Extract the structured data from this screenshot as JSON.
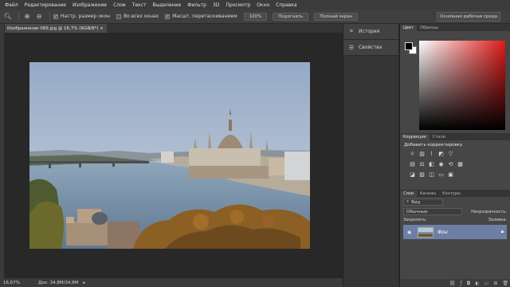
{
  "menu": [
    "Файл",
    "Редактирование",
    "Изображение",
    "Слои",
    "Текст",
    "Выделение",
    "Фильтр",
    "3D",
    "Просмотр",
    "Окно",
    "Справка"
  ],
  "options": {
    "checkbox_resize": "Настр. размер окон",
    "checkbox_all_windows": "Во всех окнах",
    "checkbox_scrubby": "Масшт. перетаскиванием",
    "btn_100": "100%",
    "btn_fit": "Подогнать",
    "btn_fullscreen": "Полный экран",
    "workspace": "Основная рабочая среда"
  },
  "document": {
    "tab_title": "Изображение 089.jpg @ 16,7% (RGB/8*)",
    "zoom": "16,67%",
    "doc_size": "Док: 34,8M/34,8M"
  },
  "dock": {
    "history": "История",
    "properties": "Свойства"
  },
  "panels": {
    "color_tabs": [
      "Цвет",
      "Образцы"
    ],
    "adj_tabs": [
      "Коррекция",
      "Стили"
    ],
    "adj_title": "Добавить корректировку",
    "layer_tabs": [
      "Слои",
      "Каналы",
      "Контуры"
    ],
    "layer_kind": "Вид",
    "blend_mode": "Обычные",
    "opacity_label": "Непрозрачность:",
    "lock_label": "Закрепить:",
    "fill_label": "Заливка:",
    "layer_name": "Фон"
  },
  "colors": {
    "foreground": "#000000",
    "background": "#ffffff",
    "hue": "#e01a1a",
    "layer_selected": "#6d7fa5"
  }
}
